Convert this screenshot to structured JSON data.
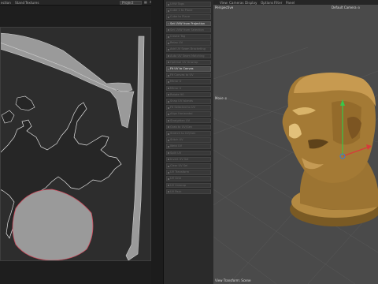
{
  "uv_editor": {
    "menu": [
      "ection",
      "Stand",
      "Textures"
    ],
    "project_select": "Project",
    "tool_icons": [
      "▦",
      "⚙",
      "▤"
    ]
  },
  "tool_palette": {
    "items": [
      {
        "label": "UVW Tags",
        "style": "dim"
      },
      {
        "label": "Cube 1 to Plane",
        "style": "dim"
      },
      {
        "label": "Cube to Plane",
        "style": "dim"
      },
      {
        "label": "Set UVW from Projection",
        "style": "hl"
      },
      {
        "label": "Set UVW from Selection",
        "style": "dim"
      },
      {
        "label": "Create Tag",
        "style": "dim"
      },
      {
        "label": "Relax UV",
        "style": "dim"
      },
      {
        "label": "Add UV Seam Bracketing",
        "style": "dim"
      },
      {
        "label": "Auto UV Seam Matching",
        "style": "dim"
      },
      {
        "label": "Optimal UV Unwrap",
        "style": "dim"
      },
      {
        "label": "Fit UV to Canvas",
        "style": "hl"
      },
      {
        "label": "Fit Canvas to UV",
        "style": "dim"
      },
      {
        "label": "Mirror U",
        "style": "dim"
      },
      {
        "label": "Mirror V",
        "style": "dim"
      },
      {
        "label": "Rotate 90",
        "style": "dim"
      },
      {
        "label": "Snap UV Islands",
        "style": "dim"
      },
      {
        "label": "Fit Selected to UV",
        "style": "dim"
      },
      {
        "label": "Align Horizontal",
        "style": "dim"
      },
      {
        "label": "Straighten UV",
        "style": "dim"
      },
      {
        "label": "Grab to UV/Gen",
        "style": "dim"
      },
      {
        "label": "Stretch to UV/Gen",
        "style": "dim"
      },
      {
        "label": "Stitch UV",
        "style": "dim"
      },
      {
        "label": "Weld UV",
        "style": "dim"
      },
      {
        "label": "Split UV",
        "style": "dim"
      },
      {
        "label": "Invert UV Sel",
        "style": "dim"
      },
      {
        "label": "Clear UV Sel",
        "style": "dim"
      },
      {
        "label": "UV Transform",
        "style": "dim"
      },
      {
        "label": "UV Grid",
        "style": "dim"
      },
      {
        "label": "UV Unwrap",
        "style": "dim"
      },
      {
        "label": "UV Pack",
        "style": "dim"
      }
    ]
  },
  "viewport": {
    "menu": [
      "View",
      "Cameras",
      "Display",
      "Options",
      "Filter",
      "Panel"
    ],
    "view_label": "Perspective",
    "camera_label": "Default Camera ⊙",
    "move_label": "Move ⊕",
    "footer": "View Transform: Scene"
  },
  "colors": {
    "uv_background": "#2d2d2d",
    "uv_island_fill": "#9a9a9a",
    "uv_boundary": "#d04a5c",
    "viewport_background": "#4a4a4a",
    "bust_base": "#8a6a2e",
    "bust_highlight": "#d9b46a",
    "axis_green": "#38c84a",
    "axis_red": "#d83a3a"
  }
}
